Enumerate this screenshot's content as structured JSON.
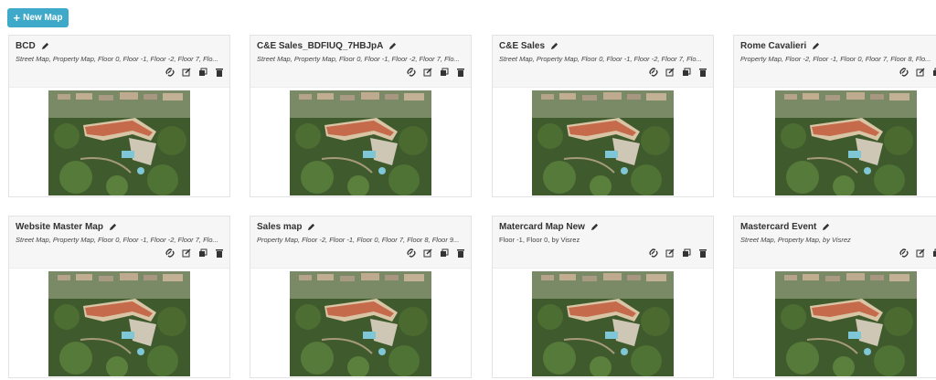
{
  "toolbar": {
    "new_map_label": "New Map"
  },
  "icons": {
    "link": "link-icon",
    "edit": "edit-icon",
    "duplicate": "duplicate-icon",
    "delete": "delete-icon",
    "pencil": "pencil-icon"
  },
  "maps": [
    {
      "title": "BCD",
      "subtitle": "Street Map, Property Map, Floor 0, Floor -1, Floor -2, Floor 7, Flo..."
    },
    {
      "title": "C&E Sales_BDFIUQ_7HBJpA",
      "subtitle": "Street Map, Property Map, Floor 0, Floor -1, Floor -2, Floor 7, Flo..."
    },
    {
      "title": "C&E Sales",
      "subtitle": "Street Map, Property Map, Floor 0, Floor -1, Floor -2, Floor 7, Flo..."
    },
    {
      "title": "Rome Cavalieri",
      "subtitle": "Property Map, Floor -2, Floor -1, Floor 0, Floor 7, Floor 8, Flo..."
    },
    {
      "title": "Website Master Map",
      "subtitle": "Street Map, Property Map, Floor 0, Floor -1, Floor -2, Floor 7, Flo..."
    },
    {
      "title": "Sales map",
      "subtitle": "Property Map, Floor -2, Floor -1, Floor 0, Floor 7, Floor 8, Floor 9..."
    },
    {
      "title": "Matercard Map New",
      "subtitle": "Floor -1, Floor 0, by Visrez"
    },
    {
      "title": "Mastercard Event",
      "subtitle": "Street Map, Property Map, by Visrez"
    }
  ]
}
